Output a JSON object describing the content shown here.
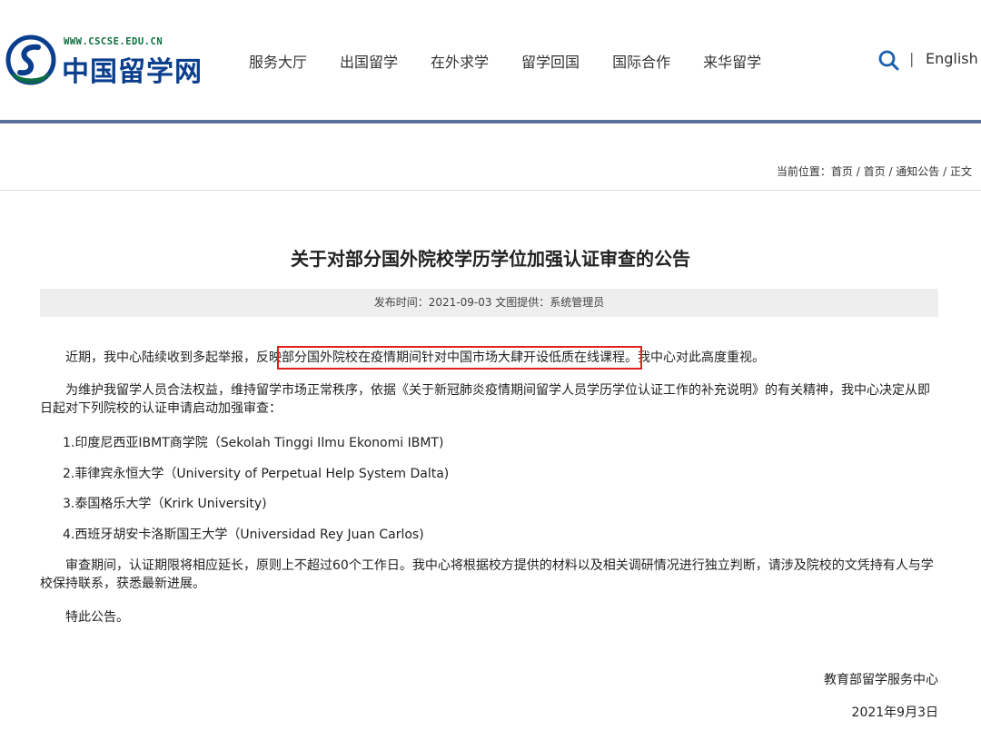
{
  "header": {
    "logo_url_text": "WWW.CSCSE.EDU.CN",
    "logo_name": "中国留学网",
    "nav": [
      "服务大厅",
      "出国留学",
      "在外求学",
      "留学回国",
      "国际合作",
      "来华留学"
    ],
    "separator": "|",
    "language": "English",
    "icons": {
      "search": "search-icon",
      "logo": "cscse-logo-icon"
    },
    "colors": {
      "header_rule": "#5b6f9b",
      "logo_blue": "#0b3f8e",
      "logo_green": "#0d6e3f",
      "highlight": "#e02020"
    }
  },
  "breadcrumb": {
    "prefix": "当前位置：",
    "items": [
      "首页",
      "首页",
      "通知公告",
      "正文"
    ],
    "separator": " / "
  },
  "article": {
    "title": "关于对部分国外院校学历学位加强认证审查的公告",
    "meta": "发布时间：2021-09-03   文图提供：系统管理员",
    "p1_before": "近期，我中心陆续收到多起举报，反映",
    "p1_highlight": "部分国外院校在疫情期间针对中国市场大肆开设低质在线课程。",
    "p1_after": "我中心对此高度重视。",
    "p2": "为维护我留学人员合法权益，维持留学市场正常秩序，依据《关于新冠肺炎疫情期间留学人员学历学位认证工作的补充说明》的有关精神，我中心决定从即日起对下列院校的认证申请启动加强审查：",
    "list": [
      "1.印度尼西亚IBMT商学院（Sekolah Tinggi Ilmu Ekonomi IBMT)",
      "2.菲律宾永恒大学（University of Perpetual Help System Dalta)",
      "3.泰国格乐大学（Krirk University)",
      "4.西班牙胡安卡洛斯国王大学（Universidad Rey Juan Carlos)"
    ],
    "p3": "审查期间，认证期限将相应延长，原则上不超过60个工作日。我中心将根据校方提供的材料以及相关调研情况进行独立判断，请涉及院校的文凭持有人与学校保持联系，获悉最新进展。",
    "p4": "特此公告。",
    "signature": "教育部留学服务中心",
    "date": "2021年9月3日"
  }
}
